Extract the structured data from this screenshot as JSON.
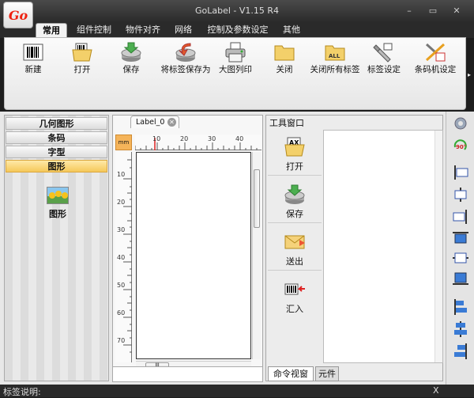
{
  "window": {
    "title": "GoLabel - V1.15 R4",
    "logo_text": "Go",
    "minimize": "–",
    "restore": "▭",
    "close": "✕"
  },
  "tabs": [
    "常用",
    "组件控制",
    "物件对齐",
    "网络",
    "控制及参数设定",
    "其他"
  ],
  "ribbon": {
    "buttons": [
      "新建",
      "打开",
      "保存",
      "将标签保存为",
      "大图列印",
      "关闭",
      "关闭所有标签",
      "标签设定",
      "条码机设定"
    ],
    "all_badge": "ALL",
    "more": "▸"
  },
  "left_panel": {
    "categories": [
      "几何图形",
      "条码",
      "字型",
      "图形"
    ],
    "selected": "图形",
    "item_label": "图形"
  },
  "editor": {
    "tab_label": "Label_0",
    "tab_close": "✕",
    "unit": "mm",
    "h_ruler": [
      "10",
      "20",
      "30",
      "40"
    ],
    "v_ruler": [
      "10",
      "20",
      "30",
      "40",
      "50",
      "60",
      "70"
    ],
    "scroll_grip": "III"
  },
  "tool_window": {
    "title": "工具窗口",
    "buttons": [
      "打开",
      "保存",
      "送出",
      "汇入"
    ],
    "tabs": [
      "命令视窗",
      "元件"
    ]
  },
  "status": {
    "label": "标签说明:",
    "x_label": "X"
  },
  "colors": {
    "accent": "#f5c85a",
    "titlebar": "#2a2a2a"
  }
}
